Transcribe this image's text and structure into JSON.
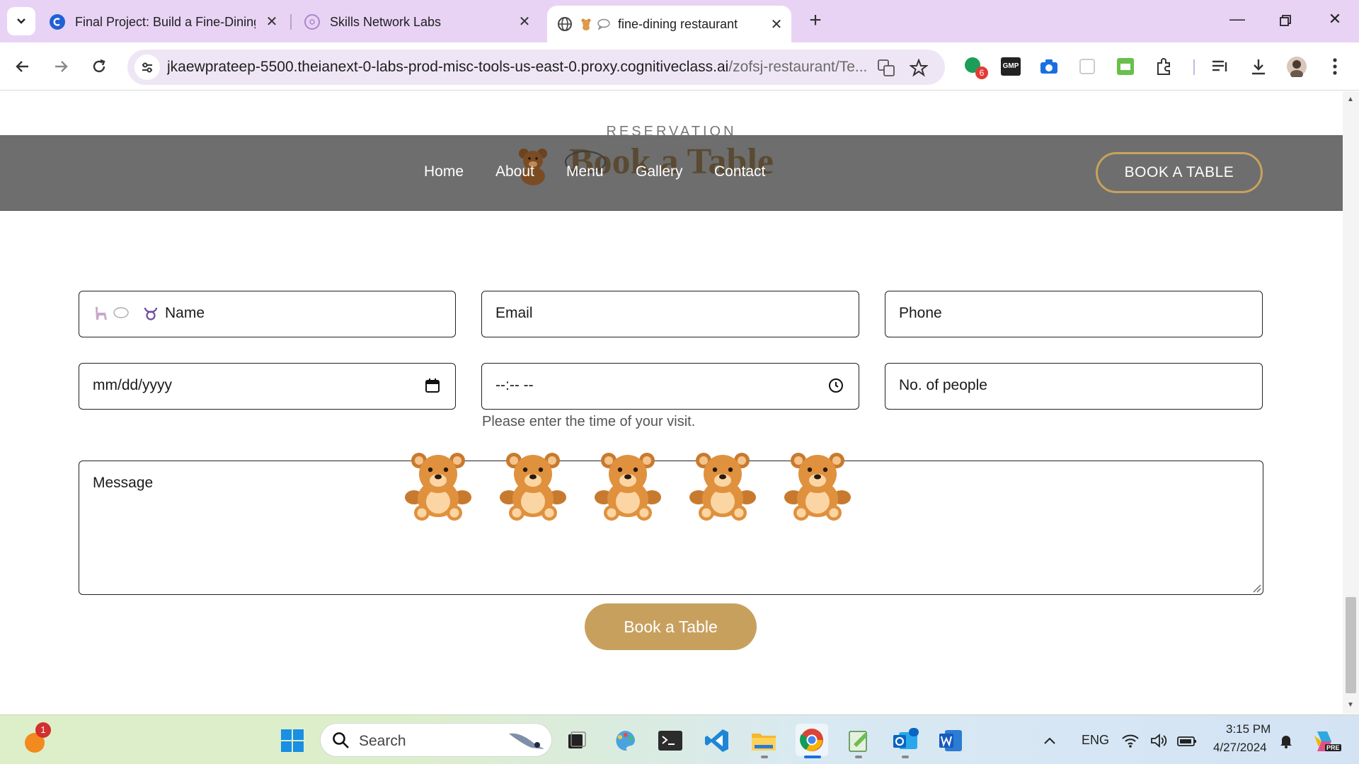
{
  "browser": {
    "tabs": [
      {
        "title": "Final Project: Build a Fine-Dining",
        "icon": "coursera-c-icon",
        "active": false
      },
      {
        "title": "Skills Network Labs",
        "icon": "skills-network-icon",
        "active": false
      },
      {
        "title": "fine-dining restaurant",
        "icon": "globe-icon",
        "active": true
      }
    ],
    "url_main": "jkaewprateep-5500.theianext-0-labs-prod-misc-tools-us-east-0.proxy.cognitiveclass.ai",
    "url_path": "/zofsj-restaurant/Te...",
    "extension_badge": "6",
    "gmp_label": "GMP"
  },
  "page": {
    "section_kicker": "RESERVATION",
    "section_title": "Book a Table",
    "nav": [
      "Home",
      "About",
      "Menu",
      "Gallery",
      "Contact"
    ],
    "header_cta": "BOOK A TABLE",
    "form": {
      "name_placeholder": "Name",
      "email_placeholder": "Email",
      "phone_placeholder": "Phone",
      "date_placeholder": "mm/dd/yyyy",
      "time_placeholder": "--:-- --",
      "people_placeholder": "No. of people",
      "time_hint": "Please enter the time of your visit.",
      "message_placeholder": "Message",
      "submit_label": "Book a Table"
    }
  },
  "taskbar": {
    "search_label": "Search",
    "notification_count": "1",
    "language": "ENG",
    "time": "3:15 PM",
    "date": "4/27/2024",
    "copilot_badge": "PRE"
  },
  "colors": {
    "accent_gold": "#c8a05e",
    "header_gray": "#6e6e6e",
    "tabbar_purple": "#e8d3f5"
  }
}
